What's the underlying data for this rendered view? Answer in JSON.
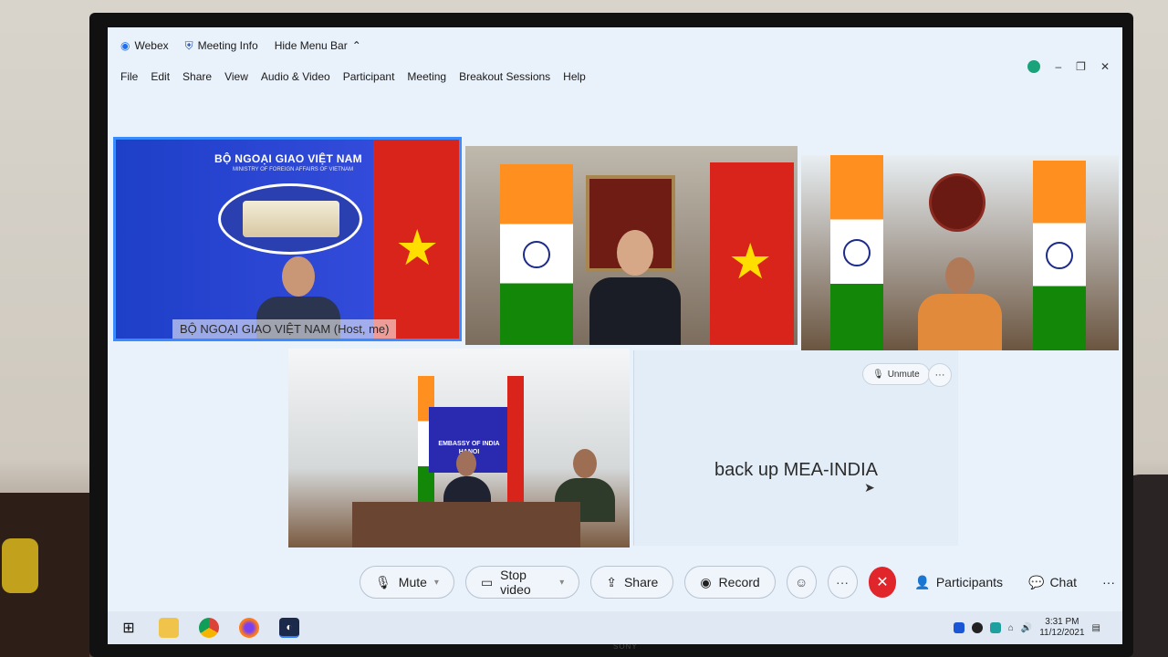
{
  "titlebar": {
    "app": "Webex",
    "meeting_info": "Meeting Info",
    "hide_menu": "Hide Menu Bar"
  },
  "menu": [
    "File",
    "Edit",
    "Share",
    "View",
    "Audio & Video",
    "Participant",
    "Meeting",
    "Breakout Sessions",
    "Help"
  ],
  "tiles": {
    "host": {
      "org_title": "BỘ NGOẠI GIAO VIỆT NAM",
      "org_sub": "MINISTRY OF FOREIGN AFFAIRS OF VIETNAM",
      "label": "BỘ NGOẠI GIAO VIỆT NAM (Host, me)"
    },
    "embassy": {
      "sign": "EMBASSY OF INDIA HANOI"
    },
    "backup": {
      "name": "back up MEA-INDIA",
      "unmute": "Unmute",
      "more": "···"
    }
  },
  "controls": {
    "mute": "Mute",
    "stop_video": "Stop video",
    "share": "Share",
    "record": "Record",
    "more": "···",
    "participants": "Participants",
    "chat": "Chat",
    "overflow": "···"
  },
  "taskbar": {
    "time": "3:31 PM",
    "date": "11/12/2021"
  },
  "monitor_brand": "SONY",
  "colors": {
    "leave_red": "#e0252b",
    "accent_blue": "#3a8bff",
    "vn_red": "#d9241c",
    "vn_star": "#ffde00"
  }
}
